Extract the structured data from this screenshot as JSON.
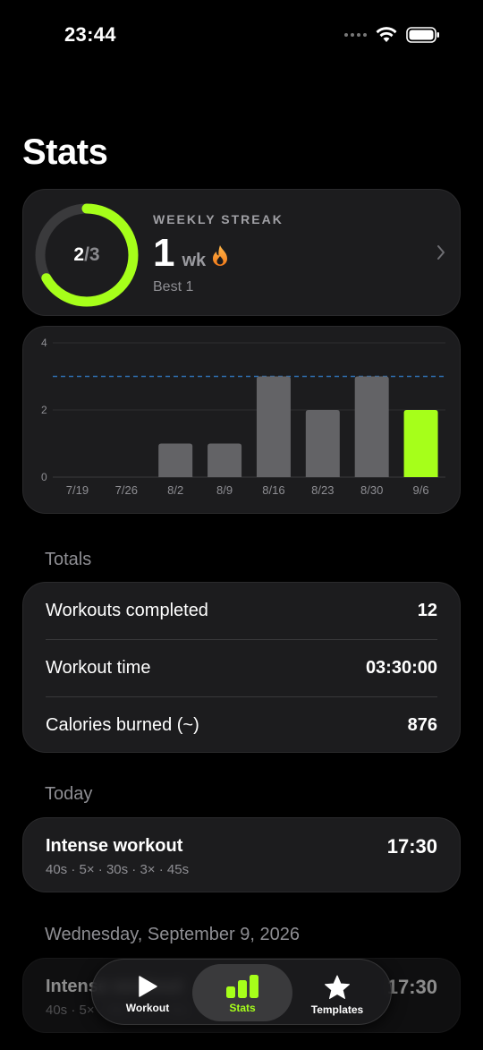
{
  "status_bar": {
    "time": "23:44"
  },
  "title": "Stats",
  "streak": {
    "heading": "WEEKLY STREAK",
    "value": "1",
    "unit": "wk",
    "best": "Best 1",
    "progress_current": "2",
    "progress_goal": "/3",
    "progress_fraction": 0.667
  },
  "chart_data": {
    "type": "bar",
    "categories": [
      "7/19",
      "7/26",
      "8/2",
      "8/9",
      "8/16",
      "8/23",
      "8/30",
      "9/6"
    ],
    "values": [
      0,
      0,
      1,
      1,
      3,
      2,
      3,
      2
    ],
    "highlight_index": 7,
    "goal_line": 3,
    "ylim": [
      0,
      4
    ],
    "yticks": [
      0,
      2,
      4
    ],
    "colors": {
      "bar": "#636366",
      "highlight": "#a6ff1a",
      "goal_line": "#2f6fb0"
    },
    "grid": true
  },
  "totals": {
    "label": "Totals",
    "rows": [
      {
        "label": "Workouts completed",
        "value": "12"
      },
      {
        "label": "Workout time",
        "value": "03:30:00"
      },
      {
        "label": "Calories burned (~)",
        "value": "876"
      }
    ]
  },
  "today": {
    "label": "Today",
    "workout": {
      "name": "Intense workout",
      "detail": "40s · 5× · 30s · 3× · 45s",
      "time": "17:30"
    }
  },
  "previous": {
    "label": "Wednesday, September 9, 2026",
    "workout": {
      "name": "Intense workout",
      "detail": "40s · 5× · 30s · 3× · 45s",
      "time": "17:30"
    }
  },
  "tabs": [
    {
      "label": "Workout",
      "icon": "play-icon"
    },
    {
      "label": "Stats",
      "icon": "bar-chart-icon"
    },
    {
      "label": "Templates",
      "icon": "star-icon"
    }
  ],
  "accent": "#a6ff1a"
}
